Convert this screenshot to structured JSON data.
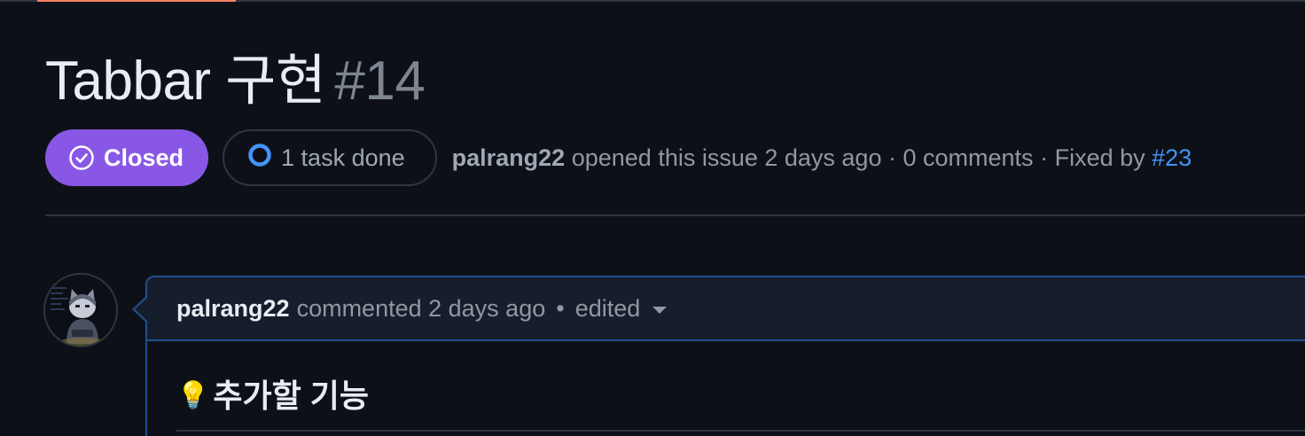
{
  "issue": {
    "title": "Tabbar 구현",
    "number": "#14",
    "state_label": "Closed",
    "task_progress": "1 task done",
    "author": "palrang22",
    "opened_text": "opened this issue 2 days ago",
    "separator": "·",
    "comments_count": "0 comments",
    "fixed_by_label": "Fixed by",
    "fixed_by_link": "#23"
  },
  "comment": {
    "author": "palrang22",
    "action": "commented 2 days ago",
    "separator": "•",
    "edited_label": "edited",
    "heading_emoji": "💡",
    "heading": "추가할 기능"
  },
  "colors": {
    "background": "#0d1117",
    "closed_badge": "#8957e5",
    "link": "#4493f8",
    "border": "#30363d",
    "comment_border": "#1f4f8f",
    "accent_tab": "#f78166"
  },
  "icons": {
    "state": "check-circle-icon",
    "task": "progress-circle-icon",
    "dropdown": "caret-down-icon",
    "heading": "light-bulb-icon"
  }
}
